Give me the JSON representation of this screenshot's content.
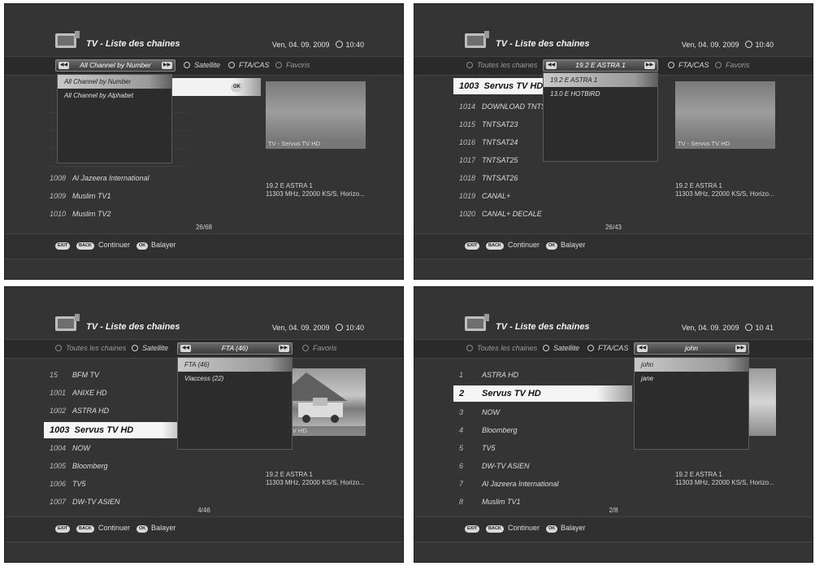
{
  "title": "TV - Liste des chaines",
  "datetime": [
    "Ven, 04. 09. 2009",
    "Ven, 04. 09. 2009",
    "Ven, 04. 09. 2009",
    "Ven, 04. 09. 2009"
  ],
  "time": [
    "10:40",
    "10:40",
    "10:40",
    "10 41"
  ],
  "tabs": {
    "toutes": "Toutes les chaines",
    "satellite": "Satellite",
    "ftacas": "FTA/CAS",
    "favoris": "Favoris"
  },
  "selectors": {
    "p0": "All Channel by Number",
    "p1": "19.2 E ASTRA 1",
    "p2": "FTA (46)",
    "p3": "john"
  },
  "dropdowns": {
    "p0": [
      "All Channel by Number",
      "All Channel by Alphabet"
    ],
    "p1": [
      "19.2 E ASTRA 1",
      "13.0 E HOTBIRD"
    ],
    "p2": [
      "FTA (46)",
      "Viaccess (22)"
    ],
    "p3": [
      "john",
      "jane"
    ]
  },
  "ok_label": "OK",
  "channels": {
    "p0": [
      {
        "num": "1008",
        "name": "Al Jazeera International"
      },
      {
        "num": "1009",
        "name": "Muslim TV1"
      },
      {
        "num": "1010",
        "name": "Muslim TV2"
      }
    ],
    "p1": [
      {
        "num": "1003",
        "name": "Servus TV HD"
      },
      {
        "num": "1014",
        "name": "DOWNLOAD TNTS"
      },
      {
        "num": "1015",
        "name": "TNTSAT23"
      },
      {
        "num": "1016",
        "name": "TNTSAT24"
      },
      {
        "num": "1017",
        "name": "TNTSAT25"
      },
      {
        "num": "1018",
        "name": "TNTSAT26"
      },
      {
        "num": "1019",
        "name": "CANAL+"
      },
      {
        "num": "1020",
        "name": "CANAL+ DECALE"
      }
    ],
    "p2": [
      {
        "num": "15",
        "name": "BFM TV"
      },
      {
        "num": "1001",
        "name": "ANIXE HD"
      },
      {
        "num": "1002",
        "name": "ASTRA HD"
      },
      {
        "num": "1003",
        "name": "Servus TV HD"
      },
      {
        "num": "1004",
        "name": "NOW"
      },
      {
        "num": "1005",
        "name": "Bloomberg"
      },
      {
        "num": "1006",
        "name": "TV5"
      },
      {
        "num": "1007",
        "name": "DW-TV ASIEN"
      }
    ],
    "p3": [
      {
        "num": "1",
        "name": "ASTRA HD"
      },
      {
        "num": "2",
        "name": "Servus TV HD"
      },
      {
        "num": "3",
        "name": "NOW"
      },
      {
        "num": "4",
        "name": "Bloomberg"
      },
      {
        "num": "5",
        "name": "TV5"
      },
      {
        "num": "6",
        "name": "DW-TV ASIEN"
      },
      {
        "num": "7",
        "name": "Al Jazeera International"
      },
      {
        "num": "8",
        "name": "Muslim TV1"
      }
    ]
  },
  "preview_caption": {
    "p0": "TV - Servus TV HD",
    "p1": "TV - Servus TV HD",
    "p2": "Servus TV HD",
    "p3": ""
  },
  "sat_line1": "19.2 E ASTRA 1",
  "sat_line2": "11303 MHz, 22000 KS/S, Horizo...",
  "pager": {
    "p0": "26/68",
    "p1": "26/43",
    "p2": "4/46",
    "p3": "2/8"
  },
  "footer": {
    "exit": "EXIT",
    "back": "BACK",
    "continuer": "Continuer",
    "ok": "OK",
    "balayer": "Balayer"
  }
}
